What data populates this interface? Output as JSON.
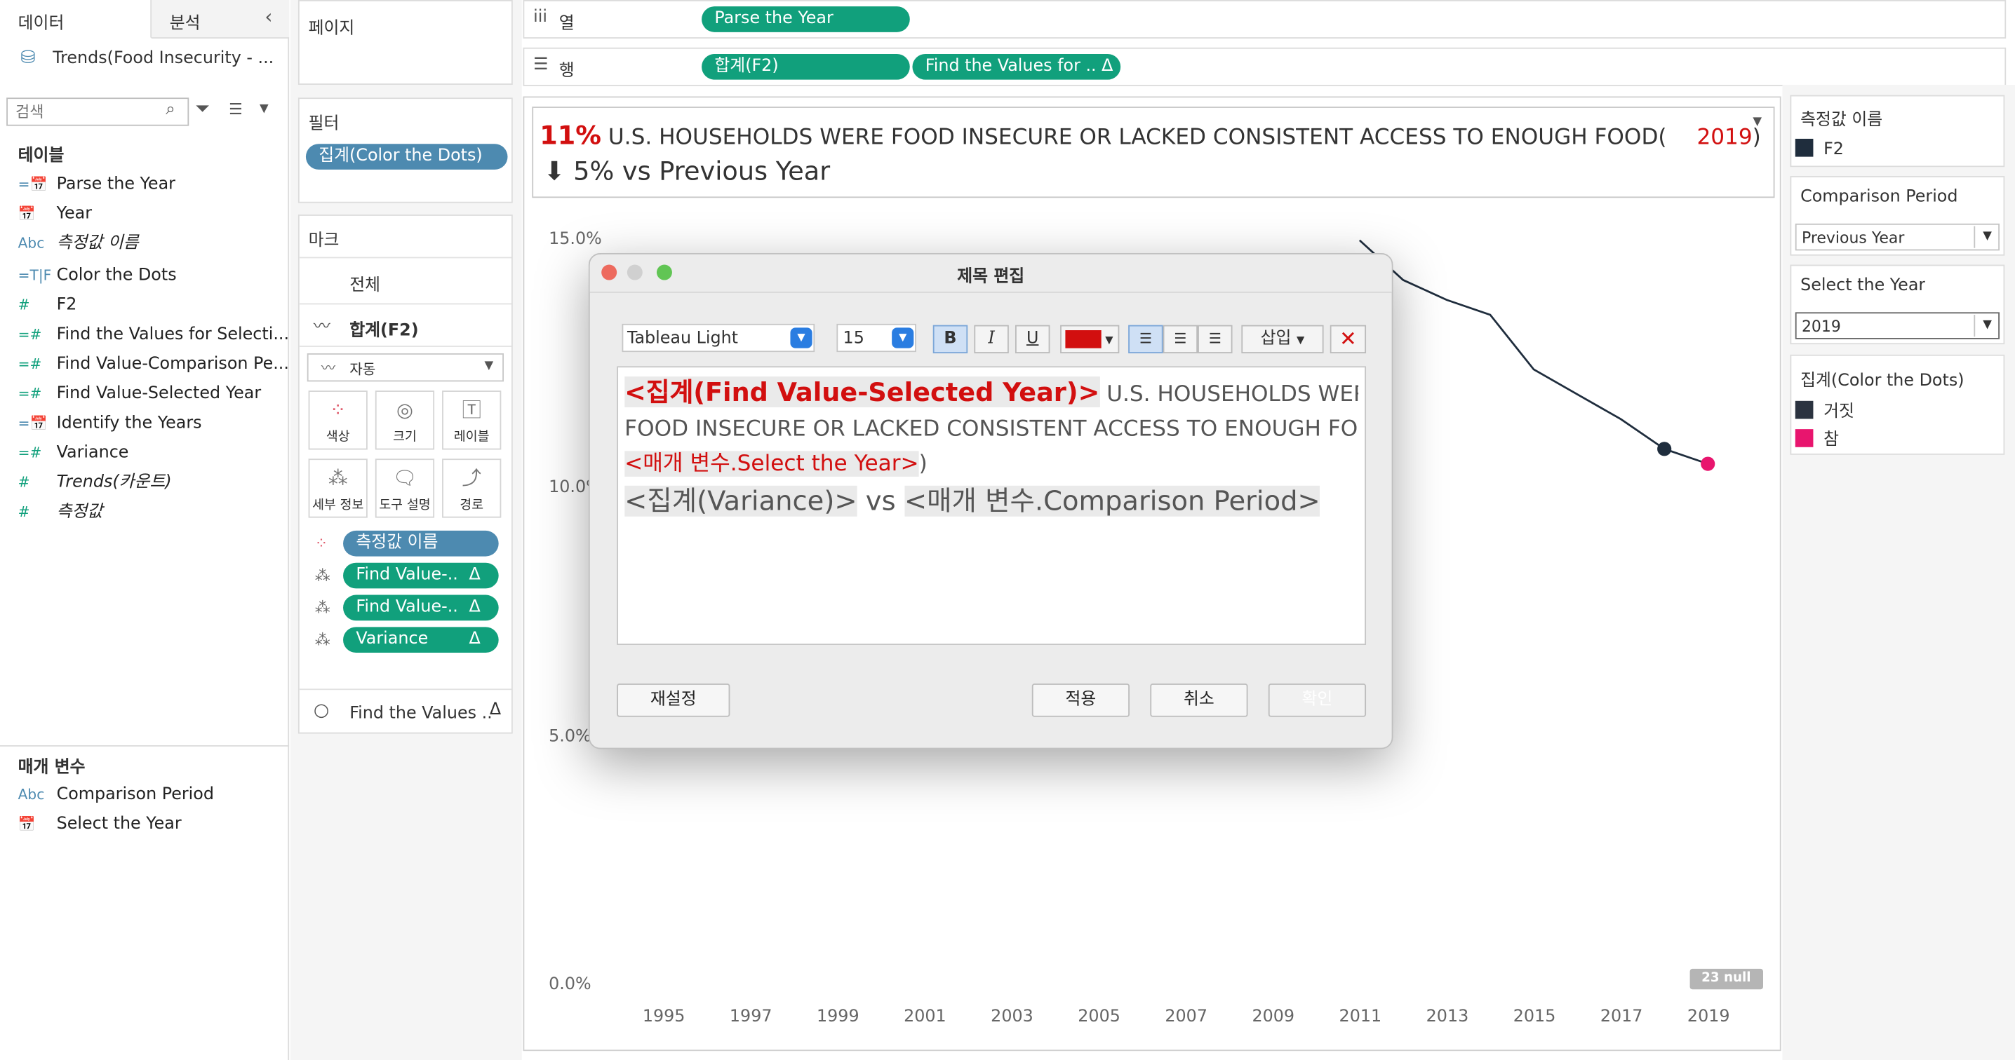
{
  "left_panel": {
    "tab_data": "데이터",
    "tab_analysis": "분석",
    "collapse_icon": "chevron-left-icon",
    "datasource": "Trends(Food Insecurity - ...",
    "search_placeholder": "검색",
    "tables_header": "테이블",
    "fields": [
      {
        "icon": "=📅",
        "label": "Parse the Year",
        "italic": false
      },
      {
        "icon": "📅",
        "label": "Year",
        "italic": false
      },
      {
        "icon": "Abc",
        "label": "측정값 이름",
        "italic": true
      },
      {
        "icon": "=T|F",
        "label": "Color the Dots",
        "italic": false
      },
      {
        "icon": "#",
        "label": "F2",
        "italic": false
      },
      {
        "icon": "=#",
        "label": "Find the Values for Selecti...",
        "italic": false
      },
      {
        "icon": "=#",
        "label": "Find Value-Comparison Pe...",
        "italic": false
      },
      {
        "icon": "=#",
        "label": "Find Value-Selected Year",
        "italic": false
      },
      {
        "icon": "=📅",
        "label": "Identify the Years",
        "italic": false
      },
      {
        "icon": "=#",
        "label": "Variance",
        "italic": false
      },
      {
        "icon": "#",
        "label": "Trends(카운트)",
        "italic": true
      },
      {
        "icon": "#",
        "label": "측정값",
        "italic": true
      }
    ],
    "params_header": "매개 변수",
    "params": [
      {
        "icon": "Abc",
        "label": "Comparison Period"
      },
      {
        "icon": "📅",
        "label": "Select the Year"
      }
    ]
  },
  "shelves": {
    "pages": "페이지",
    "filters": "필터",
    "filter_pill": "집계(Color the Dots)",
    "columns_label": "열",
    "rows_label": "행",
    "column_pill": "Parse the Year",
    "row_pill_1": "합계(F2)",
    "row_pill_2": "Find the Values for .. Δ"
  },
  "marks": {
    "header": "마크",
    "all": "전체",
    "measure": "합계(F2)",
    "type": "자동",
    "cards": [
      "색상",
      "크기",
      "레이블",
      "세부 정보",
      "도구 설명",
      "경로"
    ],
    "pills": [
      "측정값 이름",
      "Find Value-..",
      "Find Value-..",
      "Variance"
    ],
    "pill_delta": "Δ",
    "second_measure": "Find the Values ...",
    "second_delta": "Δ"
  },
  "viz_title": {
    "percent": "11%",
    "text": "U.S. HOUSEHOLDS WERE FOOD INSECURE OR LACKED CONSISTENT ACCESS TO ENOUGH FOOD(",
    "year": "2019",
    "close_paren": ")",
    "arrow": "⬇",
    "subtitle": "5% vs Previous Year"
  },
  "chart_data": {
    "type": "line",
    "x": [
      2011,
      2012,
      2013,
      2014,
      2015,
      2016,
      2017,
      2018,
      2019
    ],
    "values": [
      15.0,
      14.2,
      13.8,
      13.5,
      12.4,
      11.9,
      11.4,
      10.8,
      10.5
    ],
    "y_ticks": [
      "15.0%",
      "10.0%",
      "5.0%",
      "0.0%"
    ],
    "x_ticks": [
      "1995",
      "1997",
      "1999",
      "2001",
      "2003",
      "2005",
      "2007",
      "2009",
      "2011",
      "2013",
      "2015",
      "2017",
      "2019"
    ],
    "xlim": [
      1994,
      2020
    ],
    "ylim": [
      0,
      16
    ],
    "line_color": "#1f2d3d",
    "dot_false_color": "#1f2d3d",
    "dot_true_color": "#e8156e",
    "null_badge": "23 null"
  },
  "right_panel": {
    "measure_names_header": "측정값 이름",
    "measure_names_item": "F2",
    "comparison_header": "Comparison Period",
    "comparison_value": "Previous Year",
    "year_header": "Select the Year",
    "year_value": "2019",
    "color_header": "집계(Color the Dots)",
    "color_false": "거짓",
    "color_true": "참",
    "color_false_hex": "#2b3340",
    "color_true_hex": "#e8156e"
  },
  "dialog": {
    "title": "제목 편집",
    "font_name": "Tableau Light",
    "font_size": "15",
    "bold": "B",
    "italic": "I",
    "underline": "U",
    "text_color": "#d20f0f",
    "insert_label": "삽입",
    "line1_tag": "<집계(Find Value-Selected Year)>",
    "line1_rest": " U.S. HOUSEHOLDS WERE",
    "line2": "FOOD INSECURE OR LACKED CONSISTENT ACCESS TO ENOUGH FOOD(",
    "line3_tag": "<매개 변수.Select the Year>",
    "line3_rest": ")",
    "line4_tag1": "<집계(Variance)>",
    "line4_mid": " vs ",
    "line4_tag2": "<매개 변수.Comparison Period>",
    "reset_label": "재설정",
    "apply_label": "적용",
    "cancel_label": "취소",
    "ok_label": "확인"
  }
}
